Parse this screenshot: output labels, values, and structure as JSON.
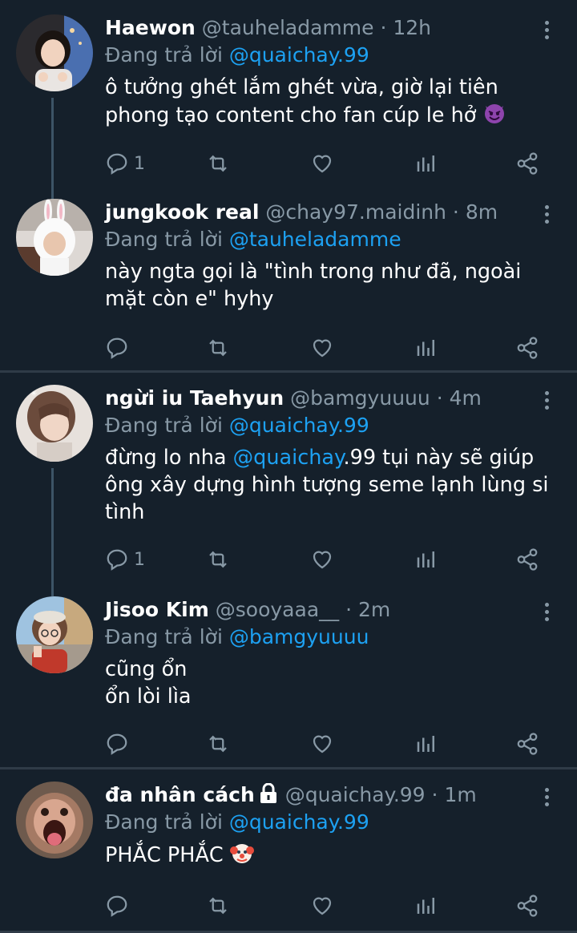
{
  "tweets": [
    {
      "name": "Haewon",
      "handle": "@tauheladamme",
      "time": "12h",
      "reply_prefix": "Đang trả lời",
      "reply_to": "@quaichay.99",
      "text": "ô tưởng ghét lắm ghét vừa, giờ lại tiên\nphong tạo content cho fan cúp le hở",
      "emoji": "devil-emoji",
      "reply_count": "1",
      "avatar": "photo-girl-dark-hair"
    },
    {
      "name": "jungkook real",
      "handle": "@chay97.maidinh",
      "time": "8m",
      "reply_prefix": "Đang trả lời",
      "reply_to": "@tauheladamme",
      "text": "này ngta gọi là \"tình trong như đã, ngoài\nmặt còn e\" hyhy",
      "reply_count": "",
      "avatar": "photo-bunny-costume"
    },
    {
      "name": "ngừi iu Taehyun",
      "handle": "@bamgyuuuu",
      "time": "4m",
      "reply_prefix": "Đang trả lời",
      "reply_to": "@quaichay.99",
      "text_before": "đừng lo nha ",
      "text_mention": "@quaichay",
      "text_after": ".99 tụi này sẽ giúp\nông xây dựng hình tượng seme lạnh lùng si\ntình",
      "reply_count": "1",
      "avatar": "photo-long-hair"
    },
    {
      "name": "Jisoo Kim",
      "handle": "@sooyaaa__",
      "time": "2m",
      "reply_prefix": "Đang trả lời",
      "reply_to": "@bamgyuuuu",
      "text": "cũng ổn\nổn lòi lìa",
      "reply_count": "",
      "avatar": "photo-girl-glasses"
    },
    {
      "name": "đa nhân cách",
      "handle": "@quaichay.99",
      "time": "1m",
      "reply_prefix": "Đang trả lời",
      "reply_to": "@quaichay.99",
      "text": "PHẮC PHẮC",
      "emoji": "clown-emoji",
      "locked": true,
      "reply_count": "",
      "avatar": "photo-monkey-face"
    }
  ],
  "sep_dot": "·",
  "colors": {
    "background": "#15202b",
    "mention": "#1da1f2",
    "muted": "#8899a6",
    "separator": "#2f3b47"
  }
}
